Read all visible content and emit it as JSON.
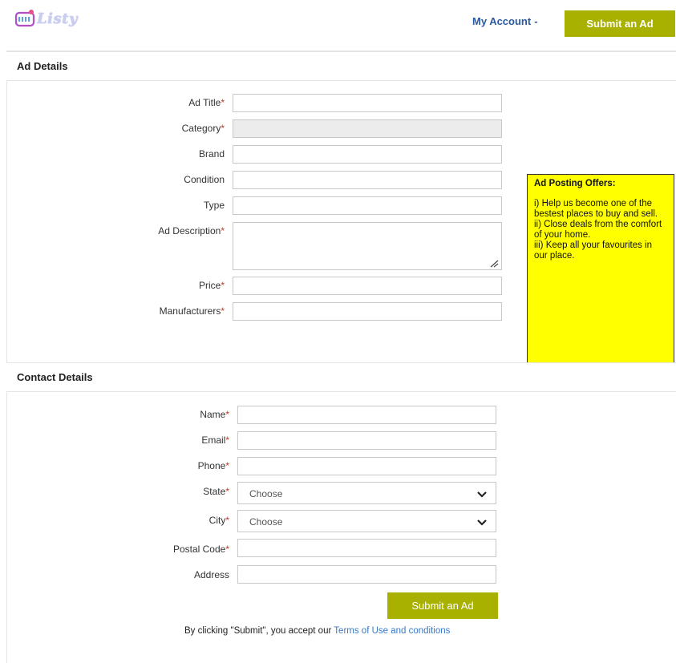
{
  "header": {
    "logo_text": "Listy",
    "my_account_label": "My Account",
    "my_account_caret": "-",
    "submit_ad_label": "Submit an Ad",
    "brand_color": "#a8b000"
  },
  "ad_details": {
    "title": "Ad Details",
    "fields": {
      "ad_title": {
        "label": "Ad Title",
        "value": ""
      },
      "category": {
        "label": "Category",
        "value": ""
      },
      "brand": {
        "label": "Brand",
        "value": ""
      },
      "condition": {
        "label": "Condition",
        "value": ""
      },
      "type": {
        "label": "Type",
        "value": ""
      },
      "ad_description": {
        "label": "Ad Description",
        "value": ""
      },
      "price": {
        "label": "Price",
        "value": ""
      },
      "manufacturers": {
        "label": "Manufacturers",
        "value": ""
      }
    },
    "required_mark": "*"
  },
  "offers": {
    "title": "Ad Posting Offers:",
    "items": [
      "i) Help us become one of the bestest places to buy and sell.",
      "ii) Close deals from the comfort of your home.",
      "iii) Keep all your favourites in our place."
    ],
    "background": "#ffff00"
  },
  "contact_details": {
    "title": "Contact Details",
    "fields": {
      "name": {
        "label": "Name",
        "value": ""
      },
      "email": {
        "label": "Email",
        "value": ""
      },
      "phone": {
        "label": "Phone",
        "value": ""
      },
      "state": {
        "label": "State",
        "selected": "Choose"
      },
      "city": {
        "label": "City",
        "selected": "Choose"
      },
      "postal_code": {
        "label": "Postal Code",
        "value": ""
      },
      "address": {
        "label": "Address",
        "value": ""
      }
    }
  },
  "footer": {
    "submit_label": "Submit an Ad",
    "terms_prefix": "By clicking \"Submit\", you accept our ",
    "terms_link": "Terms of Use and conditions"
  }
}
